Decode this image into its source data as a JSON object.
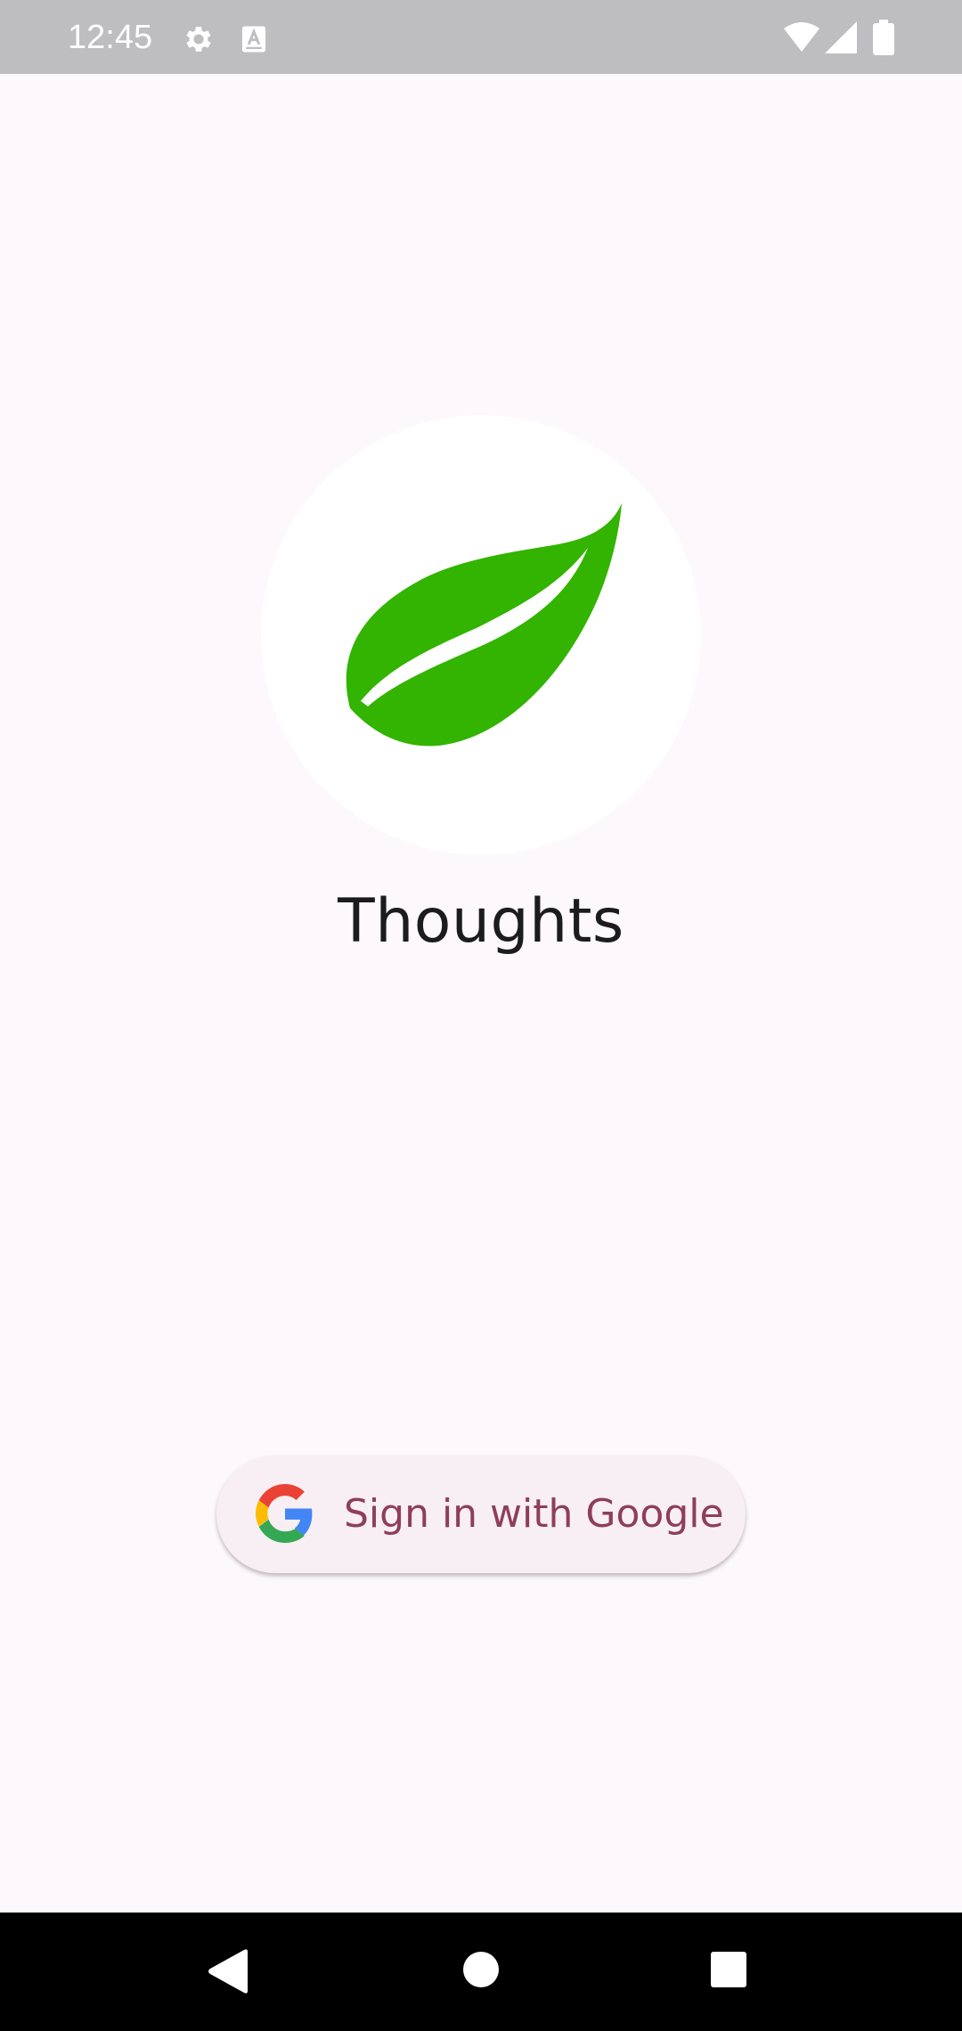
{
  "status_bar": {
    "time": "12:45",
    "icons": [
      "gear-icon",
      "keyboard-a-icon",
      "wifi-icon",
      "signal-icon",
      "battery-icon"
    ],
    "background": "#bebdbf"
  },
  "app": {
    "title": "Thoughts",
    "logo": "leaf-icon",
    "logo_color": "#32b400"
  },
  "sign_in": {
    "label": "Sign in with Google",
    "icon": "google-g-icon",
    "text_color": "#8f3d5d",
    "background": "#f7eff3"
  },
  "nav_bar": {
    "buttons": [
      "back",
      "home",
      "recents"
    ]
  }
}
